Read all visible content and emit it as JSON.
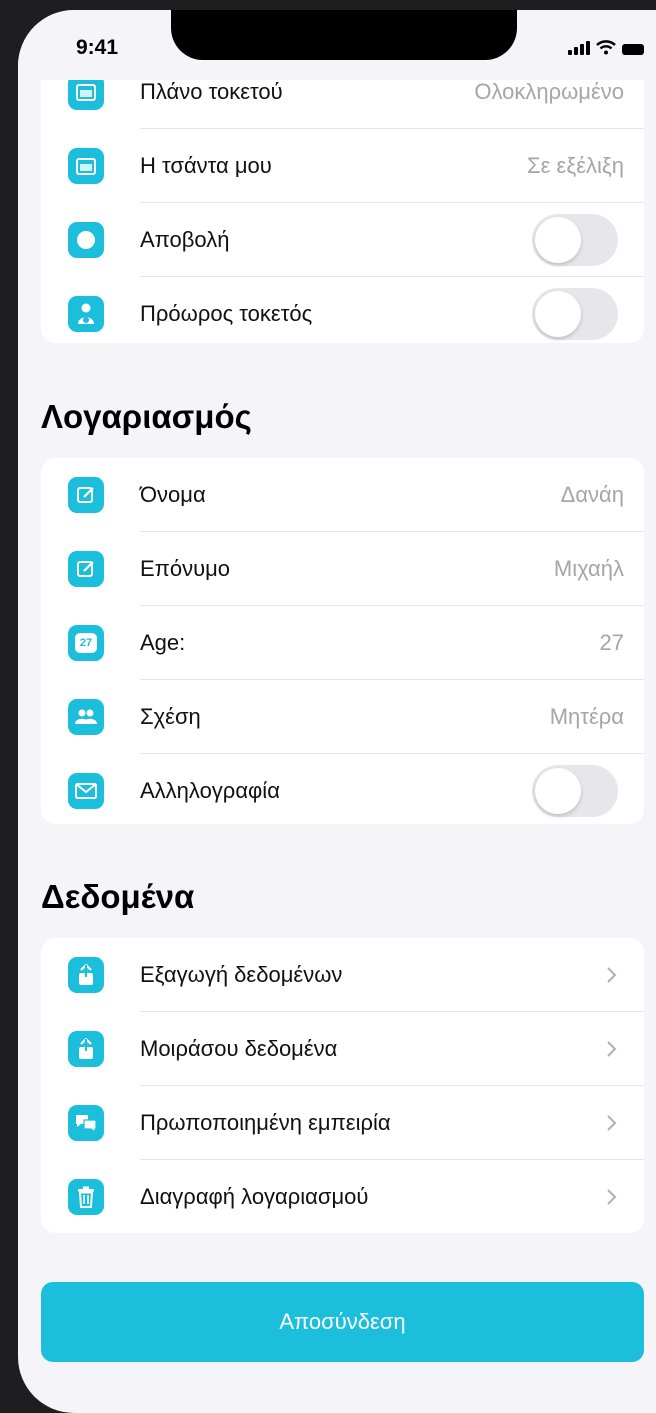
{
  "status_bar": {
    "time": "9:41"
  },
  "pregnancy": {
    "items": [
      {
        "label": "Πλάνο τοκετού",
        "value": "Ολοκληρωμένο"
      },
      {
        "label": "Η τσάντα μου",
        "value": "Σε εξέλιξη"
      },
      {
        "label": "Αποβολή",
        "toggle": false
      },
      {
        "label": "Πρόωρος τοκετός",
        "toggle": false
      }
    ]
  },
  "account": {
    "title": "Λογαριασμός",
    "items": [
      {
        "label": "Όνομα",
        "value": "Δανάη"
      },
      {
        "label": "Επόνυμο",
        "value": "Μιχαήλ"
      },
      {
        "label": "Age:",
        "value": "27",
        "icon_text": "27"
      },
      {
        "label": "Σχέση",
        "value": "Μητέρα"
      },
      {
        "label": "Αλληλογραφία",
        "toggle": false
      }
    ]
  },
  "data_section": {
    "title": "Δεδομένα",
    "items": [
      {
        "label": "Εξαγωγή δεδομένων"
      },
      {
        "label": "Μοιράσου δεδομένα"
      },
      {
        "label": "Πρωποποιημένη εμπειρία"
      },
      {
        "label": "Διαγραφή λογαριασμού"
      }
    ]
  },
  "logout": {
    "label": "Αποσύνδεση"
  },
  "colors": {
    "accent": "#1bbfdc",
    "background": "#f4f4f9",
    "card": "#ffffff",
    "secondary_text": "#a5a5aa"
  }
}
